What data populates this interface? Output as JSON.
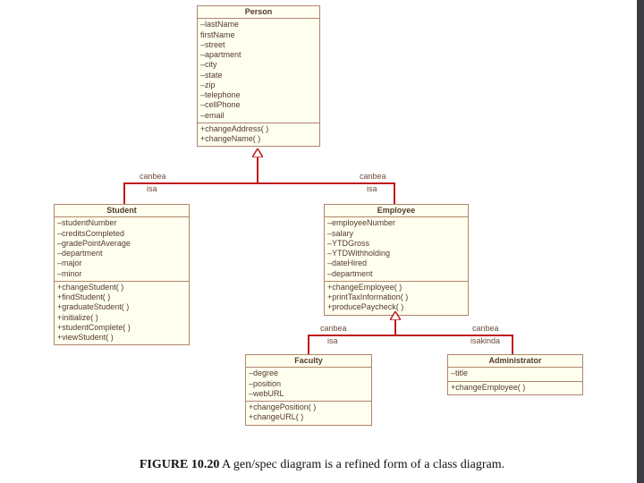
{
  "caption": {
    "bold": "FIGURE 10.20",
    "rest": " A gen/spec diagram is a refined form of a class diagram."
  },
  "labels": {
    "canbea": "canbea",
    "isa": "isa",
    "isakinda": "isakinda"
  },
  "classes": {
    "person": {
      "name": "Person",
      "attrs": [
        "–lastName",
        "firstName",
        "–street",
        "–apartment",
        "–city",
        "–state",
        "–zip",
        "–telephone",
        "–cellPhone",
        "–email"
      ],
      "ops": [
        "+changeAddress( )",
        "+changeName( )"
      ]
    },
    "student": {
      "name": "Student",
      "attrs": [
        "–studentNumber",
        "–creditsCompleted",
        "–gradePointAverage",
        "–department",
        "–major",
        "–minor"
      ],
      "ops": [
        "+changeStudent( )",
        "+findStudent( )",
        "+graduateStudent( )",
        "+initialize( )",
        "+studentComplete( )",
        "+viewStudent( )"
      ]
    },
    "employee": {
      "name": "Employee",
      "attrs": [
        "–employeeNumber",
        "–salary",
        "–YTDGross",
        "–YTDWithholding",
        "–dateHired",
        "–department"
      ],
      "ops": [
        "+changeEmployee( )",
        "+printTaxInformation( )",
        "+producePaycheck( )"
      ]
    },
    "faculty": {
      "name": "Faculty",
      "attrs": [
        "–degree",
        "–position",
        "–webURL"
      ],
      "ops": [
        "+changePosition( )",
        "+changeURL( )"
      ]
    },
    "administrator": {
      "name": "Administrator",
      "attrs": [
        "–title"
      ],
      "ops": [
        "+changeEmployee( )"
      ]
    }
  }
}
